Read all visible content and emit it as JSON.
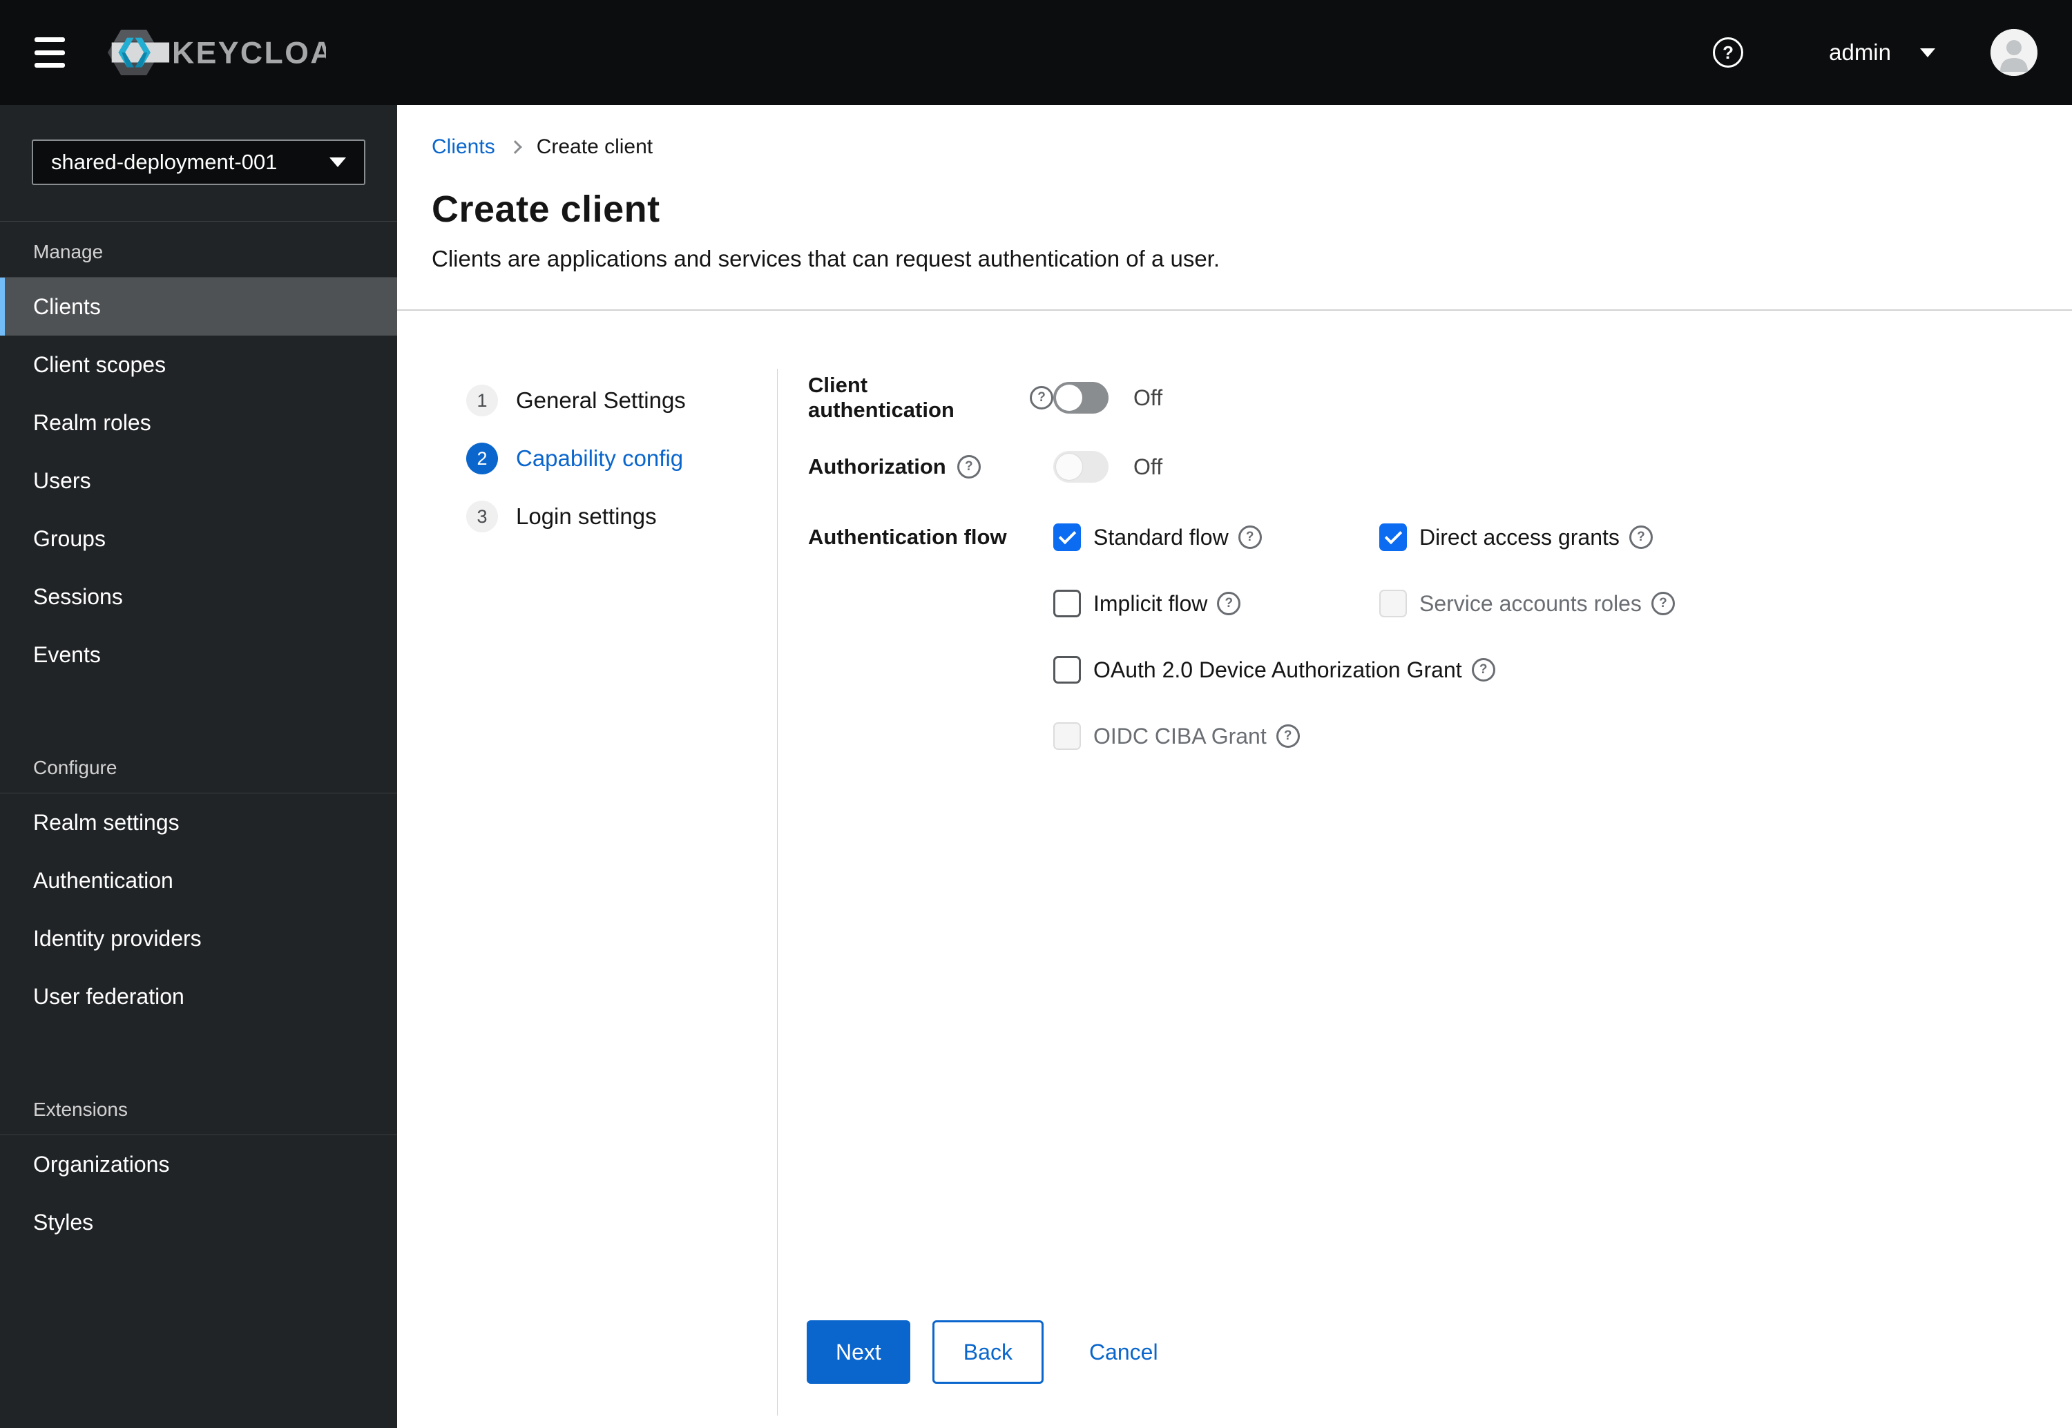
{
  "topbar": {
    "brand": "KEYCLOAK",
    "username": "admin"
  },
  "sidebar": {
    "realm": "shared-deployment-001",
    "selected_item": "Clients",
    "sections": [
      {
        "title": "Manage",
        "items": [
          "Clients",
          "Client scopes",
          "Realm roles",
          "Users",
          "Groups",
          "Sessions",
          "Events"
        ]
      },
      {
        "title": "Configure",
        "items": [
          "Realm settings",
          "Authentication",
          "Identity providers",
          "User federation"
        ]
      },
      {
        "title": "Extensions",
        "items": [
          "Organizations",
          "Styles"
        ]
      }
    ]
  },
  "breadcrumb": {
    "link": "Clients",
    "current": "Create client"
  },
  "page": {
    "title": "Create client",
    "subtitle": "Clients are applications and services that can request authentication of a user."
  },
  "wizard": {
    "active_step": "2",
    "steps": [
      {
        "number": "1",
        "label": "General Settings",
        "active": false
      },
      {
        "number": "2",
        "label": "Capability config",
        "active": true
      },
      {
        "number": "3",
        "label": "Login settings",
        "active": false
      }
    ]
  },
  "form": {
    "client_authentication": {
      "label": "Client authentication",
      "value": "Off",
      "disabled": false
    },
    "authorization": {
      "label": "Authorization",
      "value": "Off",
      "disabled": true
    },
    "auth_flow": {
      "label": "Authentication flow",
      "options": [
        {
          "label": "Standard flow",
          "state": "checked"
        },
        {
          "label": "Direct access grants",
          "state": "checked"
        },
        {
          "label": "Implicit flow",
          "state": "unchecked"
        },
        {
          "label": "Service accounts roles",
          "state": "disabled"
        },
        {
          "label": "OAuth 2.0 Device Authorization Grant",
          "state": "unchecked"
        },
        {
          "label": "OIDC CIBA Grant",
          "state": "disabled"
        }
      ]
    }
  },
  "actions": {
    "next": "Next",
    "back": "Back",
    "cancel": "Cancel"
  },
  "colors": {
    "primary": "#0a66cc",
    "checkbox_checked": "#0b6cf2",
    "selected_nav_indicator": "#73bcf7",
    "topbar_bg": "#0c0d0e",
    "sidebar_bg": "#212427",
    "brand_cyan": "#22aed2"
  }
}
